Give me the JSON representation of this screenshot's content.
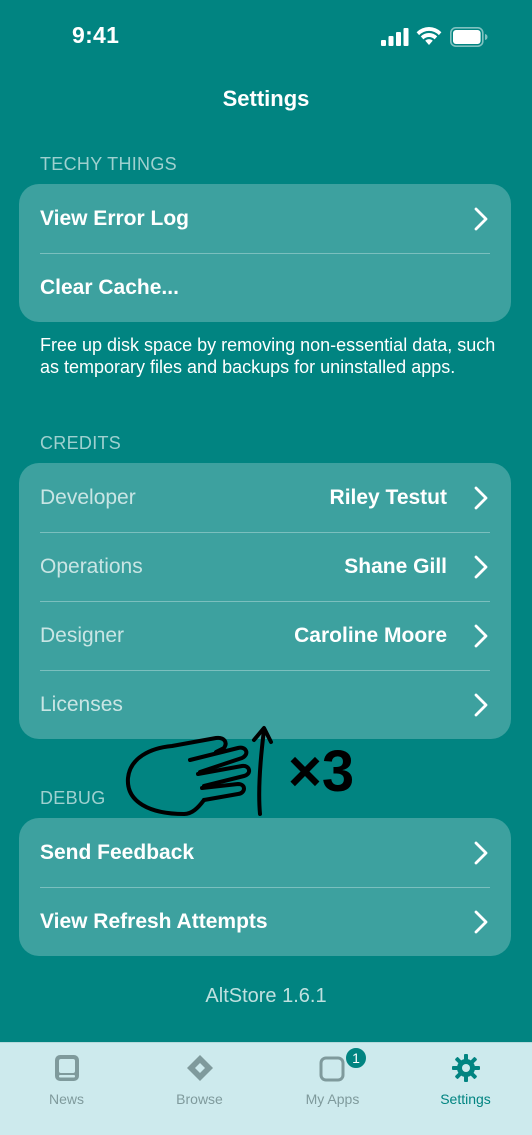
{
  "status_bar": {
    "time": "9:41"
  },
  "nav": {
    "title": "Settings"
  },
  "sections": {
    "techy": {
      "header": "TECHY THINGS",
      "rows": [
        {
          "label": "View Error Log"
        },
        {
          "label": "Clear Cache..."
        }
      ],
      "footer": "Free up disk space by removing non-essential data, such as temporary files and backups for uninstalled apps."
    },
    "credits": {
      "header": "CREDITS",
      "rows": [
        {
          "label": "Developer",
          "value": "Riley Testut"
        },
        {
          "label": "Operations",
          "value": "Shane Gill"
        },
        {
          "label": "Designer",
          "value": "Caroline Moore"
        },
        {
          "label": "Licenses",
          "value": ""
        }
      ]
    },
    "debug": {
      "header": "DEBUG",
      "rows": [
        {
          "label": "Send Feedback"
        },
        {
          "label": "View Refresh Attempts"
        }
      ]
    }
  },
  "version": "AltStore 1.6.1",
  "gesture": {
    "multiplier": "×3",
    "icon": "three-finger-swipe-up-icon"
  },
  "tabs": [
    {
      "label": "News",
      "icon": "news-icon"
    },
    {
      "label": "Browse",
      "icon": "browse-icon"
    },
    {
      "label": "My Apps",
      "icon": "my-apps-icon",
      "badge": "1"
    },
    {
      "label": "Settings",
      "icon": "gear-icon",
      "active": true
    }
  ],
  "colors": {
    "background": "#018481",
    "tab_bar": "#cdeaed",
    "accent": "#018481"
  }
}
